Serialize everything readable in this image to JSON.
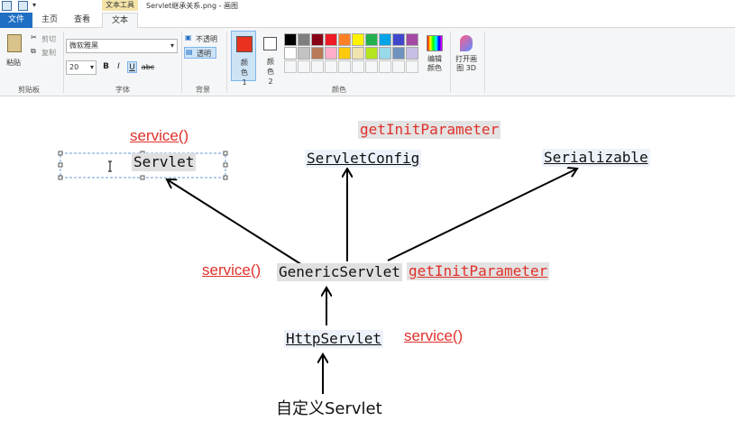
{
  "window": {
    "title": "Servlet继承关系.png - 画图",
    "context_tab_label": "文本工具"
  },
  "tabs": {
    "file": "文件",
    "home": "主页",
    "view": "查看",
    "text": "文本"
  },
  "clipboard": {
    "paste": "粘贴",
    "cut": "剪切",
    "copy": "复制",
    "group": "剪贴板"
  },
  "font": {
    "family": "微软雅黑",
    "size": "20",
    "bold": "B",
    "italic": "I",
    "underline": "U",
    "strike": "abc",
    "group": "字体"
  },
  "background": {
    "opaque": "不透明",
    "transparent": "透明",
    "group": "背景"
  },
  "colors": {
    "color1": "颜色 1",
    "color2": "颜色 2",
    "edit": "编辑颜色",
    "group": "颜色",
    "color1_value": "#e8321f",
    "color2_value": "#ffffff",
    "palette_row1": [
      "#000000",
      "#7f7f7f",
      "#880015",
      "#ed1c24",
      "#ff7f27",
      "#fff200",
      "#22b14c",
      "#00a2e8",
      "#3f48cc",
      "#a349a4"
    ],
    "palette_row2": [
      "#ffffff",
      "#c3c3c3",
      "#b97a57",
      "#ffaec9",
      "#ffc90e",
      "#efe4b0",
      "#b5e61d",
      "#99d9ea",
      "#7092be",
      "#c8bfe7"
    ]
  },
  "paint3d": {
    "label": "打开画图 3D"
  },
  "diagram": {
    "servlet": "Servlet",
    "servlet_config": "ServletConfig",
    "serializable": "Serializable",
    "generic_servlet": "GenericServlet",
    "http_servlet": "HttpServlet",
    "custom_servlet": "自定义Servlet",
    "note_service_top": "service()",
    "note_get_init_top": "getInitParameter",
    "note_service_mid": "service()",
    "note_get_init_mid": "getInitParameter",
    "note_service_http": "service()"
  }
}
